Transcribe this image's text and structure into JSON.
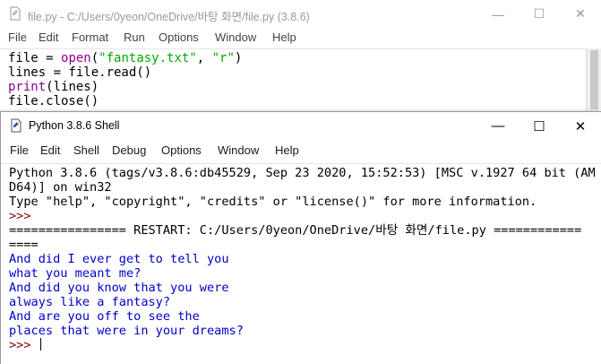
{
  "editor": {
    "title": "file.py - C:/Users/0yeon/OneDrive/바탕 화면/file.py (3.8.6)",
    "menu": [
      "File",
      "Edit",
      "Format",
      "Run",
      "Options",
      "Window",
      "Help"
    ],
    "code": {
      "line1_a": "file = ",
      "line1_b": "open",
      "line1_c": "(",
      "line1_d": "\"fantasy.txt\"",
      "line1_e": ", ",
      "line1_f": "\"r\"",
      "line1_g": ")",
      "line2": "lines = file.read()",
      "line3_a": "print",
      "line3_b": "(lines)",
      "line4": "file.close()"
    },
    "controls": {
      "minimize": "—",
      "maximize": "☐",
      "close": "✕"
    }
  },
  "shell": {
    "title": "Python 3.8.6 Shell",
    "menu": [
      "File",
      "Edit",
      "Shell",
      "Debug",
      "Options",
      "Window",
      "Help"
    ],
    "controls": {
      "minimize": "—",
      "maximize": "☐",
      "close": "✕"
    },
    "lines": {
      "banner1": "Python 3.8.6 (tags/v3.8.6:db45529, Sep 23 2020, 15:52:53) [MSC v.1927 64 bit (AM",
      "banner2": "D64)] on win32",
      "banner3": "Type \"help\", \"copyright\", \"credits\" or \"license()\" for more information.",
      "prompt1": ">>> ",
      "restart1": "================ RESTART: C:/Users/0yeon/OneDrive/바탕 화면/file.py ============",
      "restart2": "====",
      "out1": "And did I ever get to tell you",
      "out2": "what you meant me?",
      "out3": "And did you know that you were",
      "out4": "always like a fantasy?",
      "out5": "And are you off to see the",
      "out6": "places that were in your dreams?",
      "prompt2": ">>> "
    }
  },
  "colors": {
    "prompt": "#8b0000",
    "output": "#0000c8",
    "builtin": "#900090",
    "string": "#00aa00"
  }
}
